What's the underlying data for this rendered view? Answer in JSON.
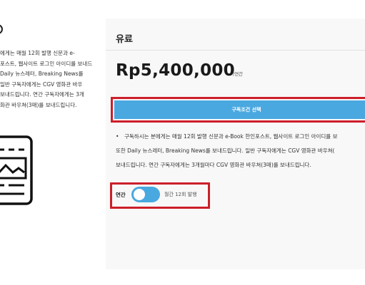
{
  "left_panel": {
    "description_lines": [
      "에게는 매월 12회 발행 신문과 e-",
      "포스트, 웹사이트 로그인 아이디를 보내드",
      "Daily 뉴스레터, Breaking News를",
      "일반 구독자에게는 CGV 영화관 바우",
      "보내드립니다. 연간 구독자에게는 3개",
      "화관 바우쳐(3매)를 보내드립니다."
    ],
    "icon": "newspaper-icon"
  },
  "card": {
    "title": "유료",
    "price": "Rp5,400,000",
    "price_unit": "/연간",
    "cta_label": "구독조건 선택",
    "description_lines": [
      "구독하시는 분에게는 매월 12회 발행 신문과 e-Book 한인포스트, 웹사이트 로그인 아이디를 보",
      "또한 Daily 뉴스레터, Breaking News를 보내드립니다. 일반 구독자에게는 CGV 영화관 바우쳐(",
      "보내드립니다. 연간 구독자에게는 3개월마다 CGV 영화관 바우쳐(3매)를 보내드립니다."
    ],
    "bullet": "•",
    "toggle": {
      "label": "연간",
      "state": "on",
      "caption": "월간 12회 발행"
    }
  },
  "colors": {
    "accent": "#4aa8e0",
    "highlight_frame": "#cc1f2a",
    "card_background": "#f8f8f8"
  }
}
